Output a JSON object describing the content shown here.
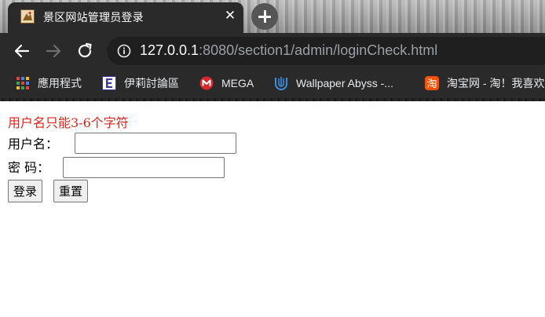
{
  "browser": {
    "tab": {
      "title": "景区网站管理员登录",
      "close_glyph": "✕"
    },
    "address": {
      "host": "127.0.0.1",
      "path": ":8080/section1/admin/loginCheck.html"
    },
    "bookmarks": [
      {
        "label": "應用程式",
        "icon": "apps-grid-icon"
      },
      {
        "label": "伊莉討論區",
        "icon": "eyny-icon"
      },
      {
        "label": "MEGA",
        "icon": "mega-icon"
      },
      {
        "label": "Wallpaper Abyss -...",
        "icon": "wallpaper-abyss-icon"
      },
      {
        "label": "淘宝网 - 淘！我喜欢",
        "icon": "taobao-icon"
      }
    ],
    "colors": {
      "chrome_dark": "#2a2a2a",
      "omnibox": "#1f1f1f",
      "url_muted": "#9aa0a6"
    }
  },
  "page": {
    "error_message": "用户名只能3-6个字符",
    "error_color": "#e0231d",
    "username_label": "用户名：",
    "password_label": "密  码：",
    "username_value": "",
    "password_value": "",
    "login_button": "登录",
    "reset_button": "重置"
  }
}
